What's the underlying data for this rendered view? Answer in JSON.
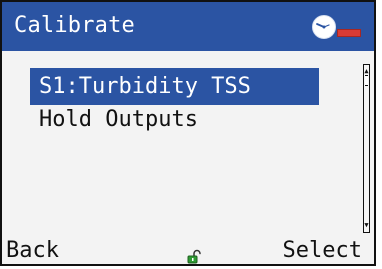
{
  "header": {
    "title": "Calibrate",
    "icons": {
      "gauge": "gauge-icon",
      "battery": "battery-icon"
    }
  },
  "menu": {
    "items": [
      {
        "label": "S1:Turbidity TSS",
        "selected": true
      },
      {
        "label": "Hold Outputs",
        "selected": false
      }
    ]
  },
  "footer": {
    "back_label": "Back",
    "select_label": "Select",
    "lock_icon": "unlocked-lock-icon"
  },
  "colors": {
    "header": "#2b54a3",
    "selection": "#2b54a3",
    "battery": "#d93b34",
    "lock": "#2f9a34"
  }
}
